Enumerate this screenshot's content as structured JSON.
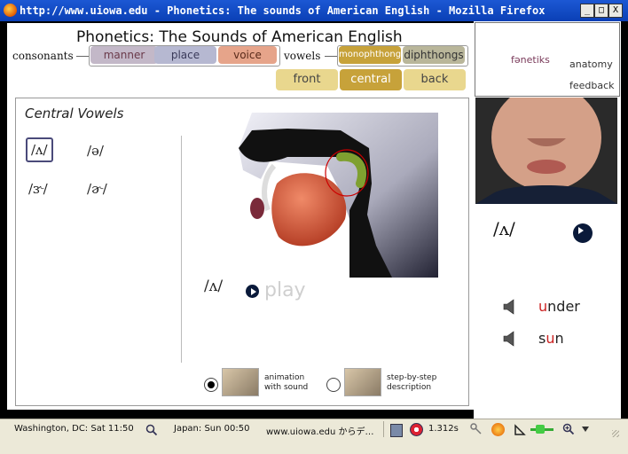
{
  "window": {
    "title": "http://www.uiowa.edu - Phonetics: The sounds of American English - Mozilla Firefox",
    "min": "_",
    "max": "□",
    "close": "X"
  },
  "header": {
    "title": "Phonetics:  The Sounds of American English",
    "consonants_label": "consonants",
    "vowels_label": "vowels",
    "tabs": {
      "manner": "manner",
      "place": "place",
      "voice": "voice",
      "monophthongs": "monophthongs",
      "diphthongs": "diphthongs"
    },
    "subtabs": {
      "front": "front",
      "central": "central",
      "back": "back"
    }
  },
  "section": {
    "title": "Central Vowels",
    "symbols": [
      "/ʌ/",
      "/ə/",
      "/ɝ/",
      "/ɚ/"
    ],
    "selected_index": 0,
    "current_symbol": "/ʌ/",
    "play_label": "play"
  },
  "options": {
    "animation": "animation\nwith sound",
    "stepbystep": "step-by-step\ndescription",
    "selected": "animation"
  },
  "right": {
    "fonetiks": "fənetiks",
    "anatomy": "anatomy",
    "feedback": "feedback",
    "symbol": "/ʌ/",
    "words": [
      {
        "highlight": "u",
        "rest": "nder"
      },
      {
        "pre": "s",
        "highlight": "u",
        "rest": "n"
      }
    ]
  },
  "statusbar": {
    "washington": "Washington, DC: Sat 11:50",
    "japan": "Japan: Sun 00:50",
    "host": "www.uiowa.edu からデ…",
    "timing": "1.312s"
  },
  "colors": {
    "accent_red": "#cc2222",
    "mono_gold": "#c7a23a"
  }
}
